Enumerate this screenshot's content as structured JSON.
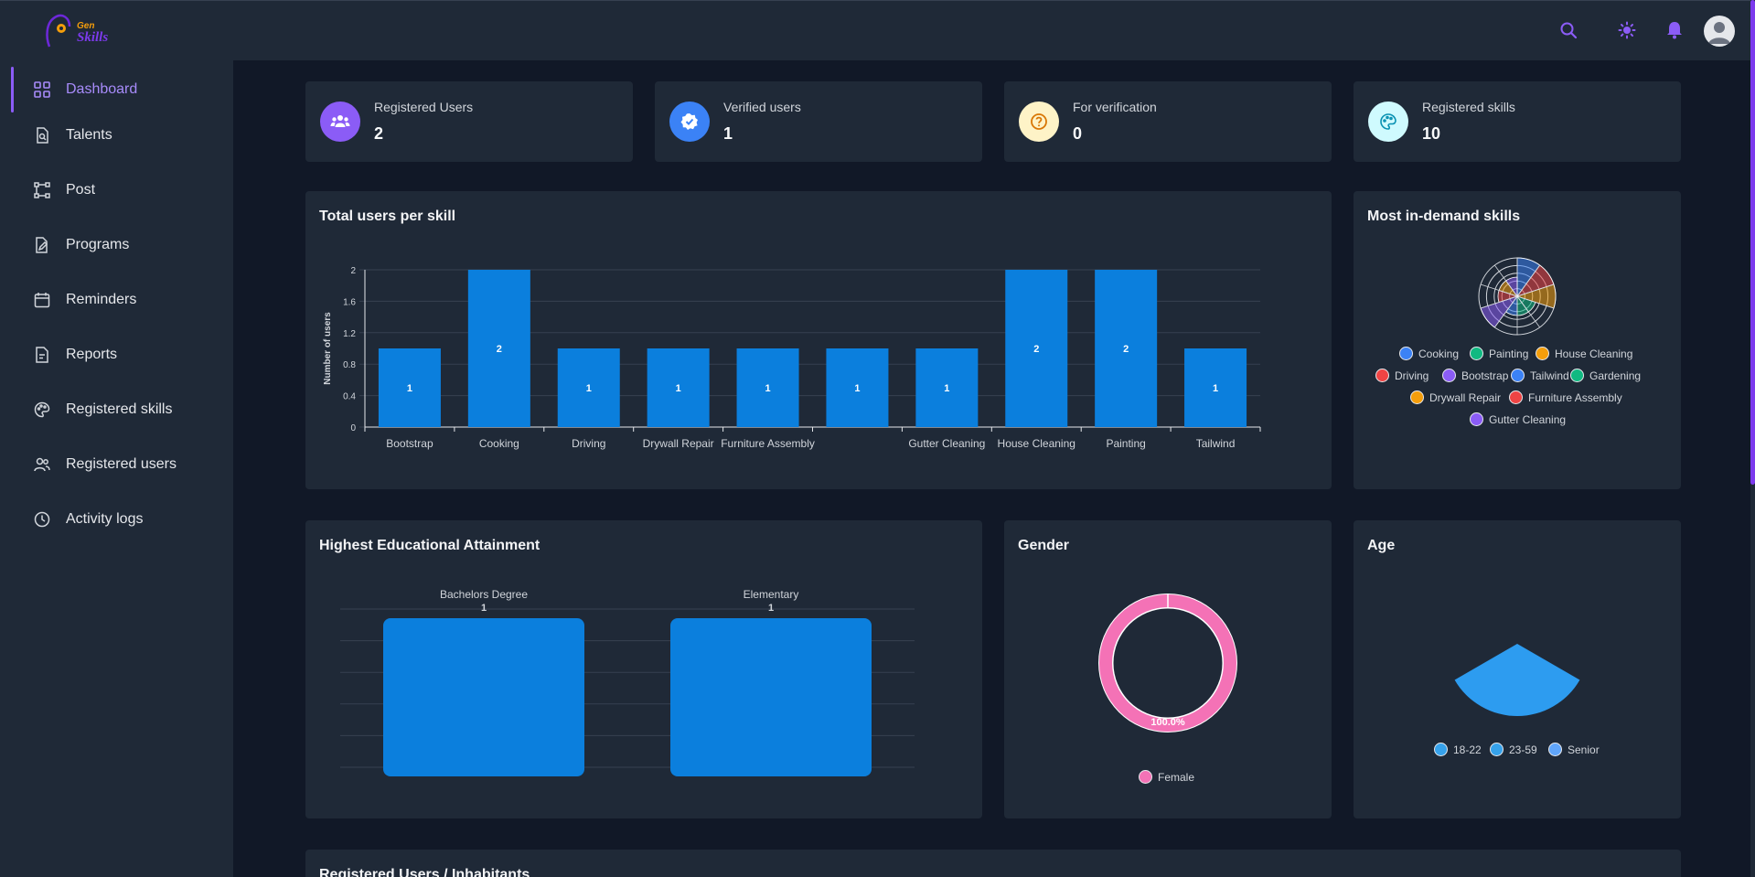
{
  "app": {
    "logo_top": "Gen",
    "logo_bottom": "Skills"
  },
  "header": {
    "icons": [
      "search-icon",
      "sun-icon",
      "bell-icon",
      "avatar"
    ]
  },
  "sidebar": {
    "items": [
      {
        "label": "Dashboard",
        "icon": "grid-icon",
        "active": true
      },
      {
        "label": "Talents",
        "icon": "document-search-icon"
      },
      {
        "label": "Post",
        "icon": "nodes-icon"
      },
      {
        "label": "Programs",
        "icon": "edit-document-icon"
      },
      {
        "label": "Reminders",
        "icon": "calendar-icon"
      },
      {
        "label": "Reports",
        "icon": "report-icon"
      },
      {
        "label": "Registered skills",
        "icon": "palette-icon"
      },
      {
        "label": "Registered users",
        "icon": "users-icon"
      },
      {
        "label": "Activity logs",
        "icon": "clock-icon"
      }
    ]
  },
  "stats": [
    {
      "label": "Registered Users",
      "value": "2",
      "color": "#8b5cf6",
      "icon": "users-group-icon"
    },
    {
      "label": "Verified users",
      "value": "1",
      "color": "#3b82f6",
      "icon": "verified-badge-icon"
    },
    {
      "label": "For verification",
      "value": "0",
      "color": "#fef3c7",
      "icon": "question-icon"
    },
    {
      "label": "Registered skills",
      "value": "10",
      "color": "#cffafe",
      "icon": "palette-icon"
    }
  ],
  "charts": {
    "users_per_skill_title": "Total users per skill",
    "in_demand_title": "Most in-demand skills",
    "education_title": "Highest Educational Attainment",
    "gender_title": "Gender",
    "age_title": "Age"
  },
  "footer_card_title": "Registered Users / Inhabitants",
  "chart_data": [
    {
      "type": "bar",
      "id": "users_per_skill",
      "categories": [
        "Bootstrap",
        "Cooking",
        "Driving",
        "Drywall Repair",
        "Furniture Assembly",
        "",
        "Gutter Cleaning",
        "House Cleaning",
        "Painting",
        "Tailwind"
      ],
      "values": [
        1,
        2,
        1,
        1,
        1,
        1,
        1,
        2,
        2,
        1
      ],
      "value_labels": [
        "1",
        "2",
        "1",
        "1",
        "1",
        "1",
        "1",
        "2",
        "2",
        "1"
      ],
      "ylabel": "Number of users",
      "ylim": [
        0,
        2
      ],
      "yticks": [
        "0",
        "0.4",
        "0.8",
        "1.2",
        "1.6",
        "2"
      ],
      "color": "#0b7fdd",
      "grid": true
    },
    {
      "type": "polar-area",
      "id": "in_demand",
      "categories": [
        "Cooking",
        "Painting",
        "House Cleaning",
        "Driving",
        "Bootstrap",
        "Tailwind",
        "Gardening",
        "Drywall Repair",
        "Furniture Assembly",
        "Gutter Cleaning"
      ],
      "values": [
        2,
        2,
        2,
        1,
        1,
        1,
        2,
        1,
        1,
        1
      ],
      "colors": [
        "#3b82f6",
        "#10b981",
        "#f59e0b",
        "#ef4444",
        "#8b5cf6",
        "#3b82f6",
        "#10b981",
        "#f59e0b",
        "#ef4444",
        "#8b5cf6"
      ],
      "legend": "bottom"
    },
    {
      "type": "bar",
      "id": "education",
      "categories": [
        "Bachelors Degree",
        "Elementary"
      ],
      "values": [
        1,
        1
      ],
      "value_labels": [
        "1",
        "1"
      ],
      "color": "#0b7fdd",
      "grid": true
    },
    {
      "type": "pie",
      "id": "gender",
      "variant": "doughnut",
      "categories": [
        "Female"
      ],
      "values": [
        100.0
      ],
      "value_labels": [
        "100.0%"
      ],
      "colors": [
        "#f472b6"
      ],
      "legend": "bottom"
    },
    {
      "type": "pie",
      "id": "age",
      "variant": "polar-area",
      "categories": [
        "18-22",
        "23-59",
        "Senior"
      ],
      "values": [
        0,
        1,
        0
      ],
      "colors": [
        "#36a2eb",
        "#36a2eb",
        "#60a5fa"
      ],
      "legend": "bottom"
    }
  ]
}
